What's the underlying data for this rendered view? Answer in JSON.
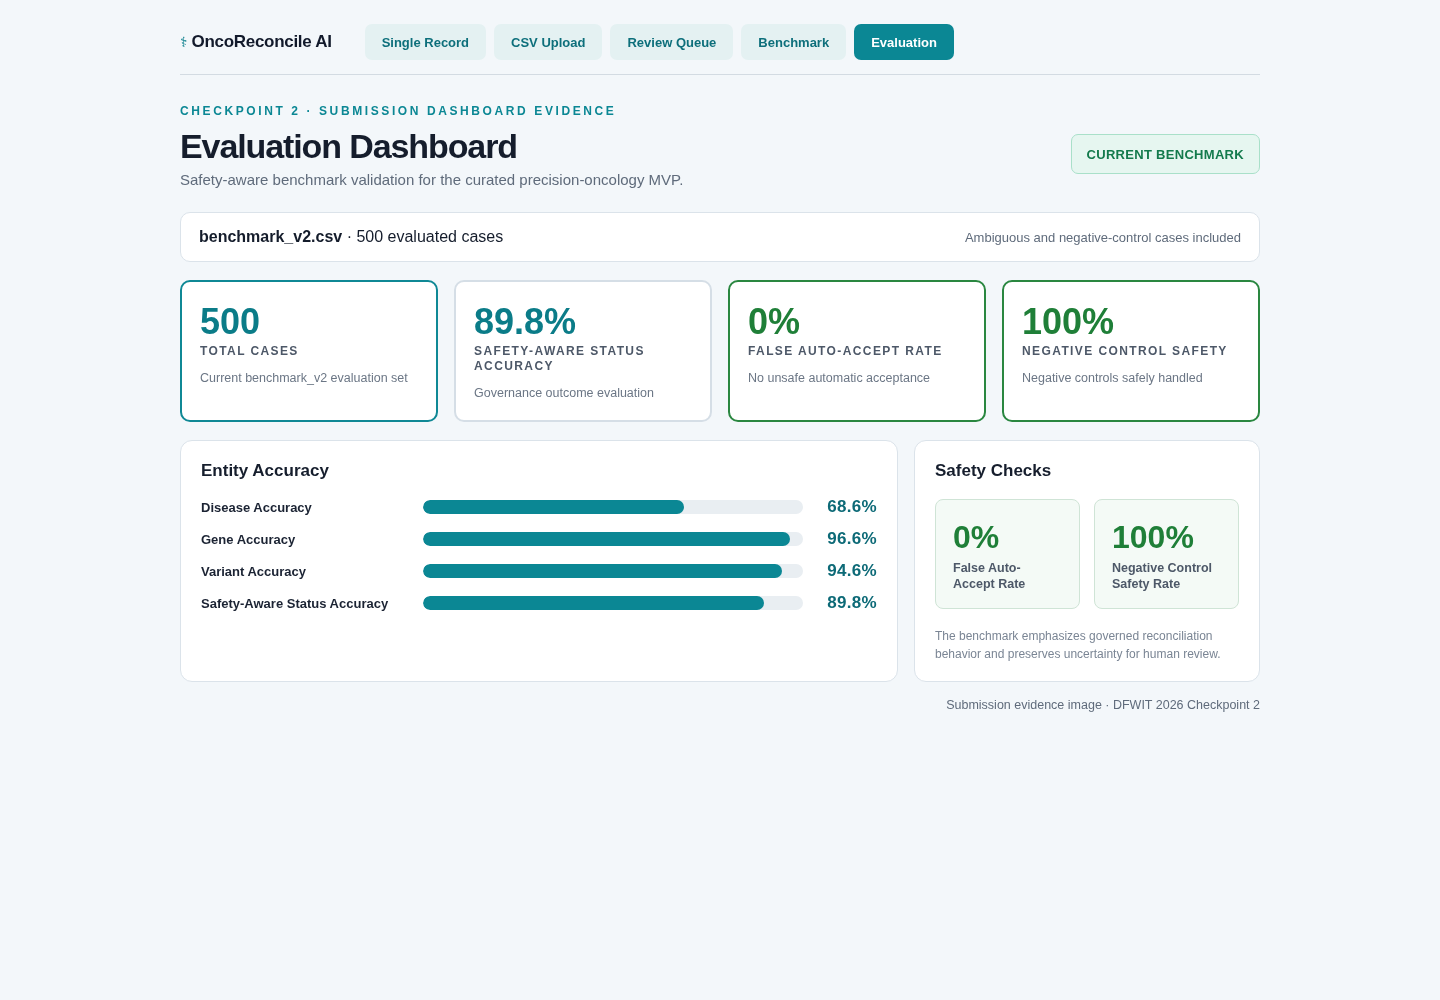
{
  "header": {
    "logo": {
      "symbol": "⚕",
      "name": "OncoReconcile AI"
    },
    "tabs": [
      {
        "label": "Single Record",
        "selected": false
      },
      {
        "label": "CSV Upload",
        "selected": false
      },
      {
        "label": "Review Queue",
        "selected": false
      },
      {
        "label": "Benchmark",
        "selected": false
      },
      {
        "label": "Evaluation",
        "selected": true
      }
    ]
  },
  "page": {
    "eyebrow": "CHECKPOINT 2 · SUBMISSION DASHBOARD EVIDENCE",
    "title": "Evaluation Dashboard",
    "subtitle": "Safety-aware benchmark validation for the curated precision-oncology MVP.",
    "badge": "CURRENT BENCHMARK"
  },
  "dataset_bar": {
    "summary": "**benchmark_v2.csv** · 500 evaluated cases",
    "note": "Ambiguous and negative-control cases included"
  },
  "stat_cards": [
    {
      "kind": "primary",
      "value": "500",
      "label": "TOTAL CASES",
      "description": "Current benchmark_v2 evaluation set"
    },
    {
      "kind": "neutral",
      "value": "89.8%",
      "label": "SAFETY-AWARE STATUS ACCURACY",
      "description": "Governance outcome evaluation"
    },
    {
      "kind": "success",
      "value": "0%",
      "label": "FALSE AUTO-ACCEPT RATE",
      "description": "No unsafe automatic acceptance"
    },
    {
      "kind": "success",
      "value": "100%",
      "label": "NEGATIVE CONTROL SAFETY",
      "description": "Negative controls safely handled"
    }
  ],
  "entity_accuracy": {
    "title": "Entity Accuracy",
    "rows": [
      {
        "label": "Disease Accuracy",
        "level": 0.686,
        "reading": "68.6%"
      },
      {
        "label": "Gene Accuracy",
        "level": 0.966,
        "reading": "96.6%"
      },
      {
        "label": "Variant Accuracy",
        "level": 0.946,
        "reading": "94.6%"
      },
      {
        "label": "Safety-Aware Status Accuracy",
        "level": 0.898,
        "reading": "89.8%"
      }
    ]
  },
  "safety_checks": {
    "title": "Safety Checks",
    "metrics": [
      {
        "value": "0%",
        "label": "False Auto-Accept Rate"
      },
      {
        "value": "100%",
        "label": "Negative Control Safety Rate"
      }
    ],
    "note": "The benchmark emphasizes governed reconciliation behavior and preserves uncertainty for human review."
  },
  "footer": "Submission evidence image · DFWIT 2026 Checkpoint 2"
}
